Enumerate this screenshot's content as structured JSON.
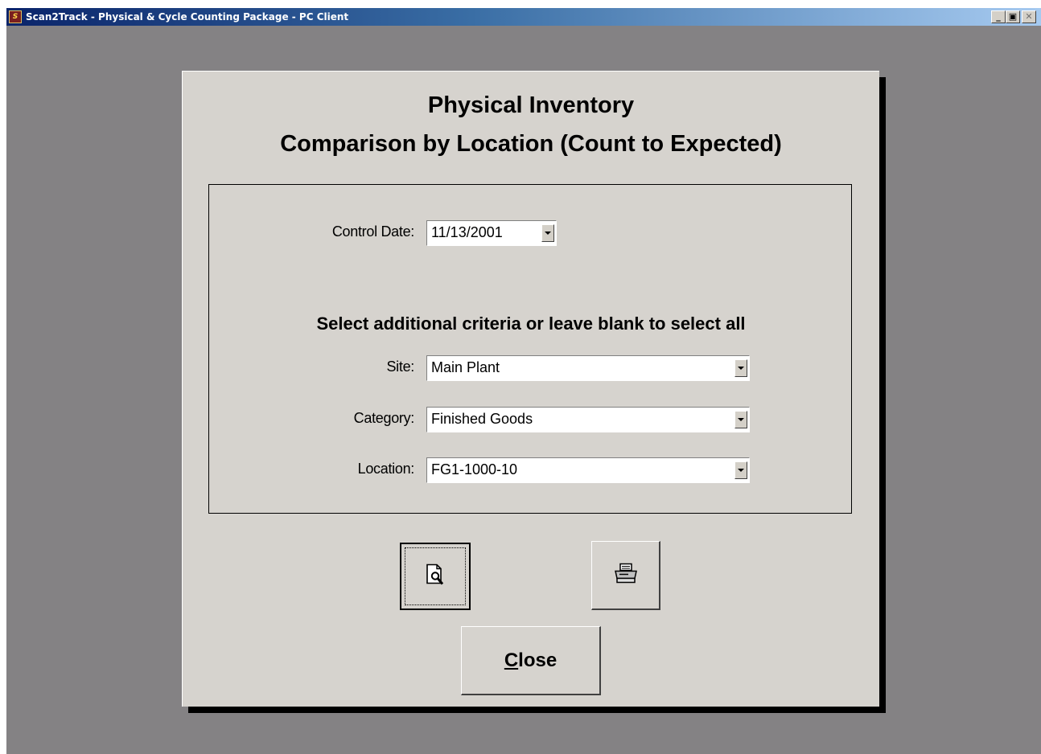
{
  "window": {
    "title": "Scan2Track - Physical & Cycle Counting Package - PC Client",
    "app_icon": "scan2track-app-icon",
    "min_glyph": "_",
    "max_glyph": "▣",
    "close_glyph": "✕"
  },
  "dialog": {
    "title_line1": "Physical Inventory",
    "title_line2": "Comparison by Location (Count to Expected)"
  },
  "criteria": {
    "control_date_label": "Control Date:",
    "control_date_value": "11/13/2001",
    "heading": "Select additional criteria or leave blank to select all",
    "site_label": "Site:",
    "site_value": "Main Plant",
    "category_label": "Category:",
    "category_value": "Finished Goods",
    "location_label": "Location:",
    "location_value": "FG1-1000-10"
  },
  "buttons": {
    "preview_icon": "print-preview-icon",
    "print_icon": "printer-icon",
    "close_label_accel": "C",
    "close_label_rest": "lose"
  }
}
